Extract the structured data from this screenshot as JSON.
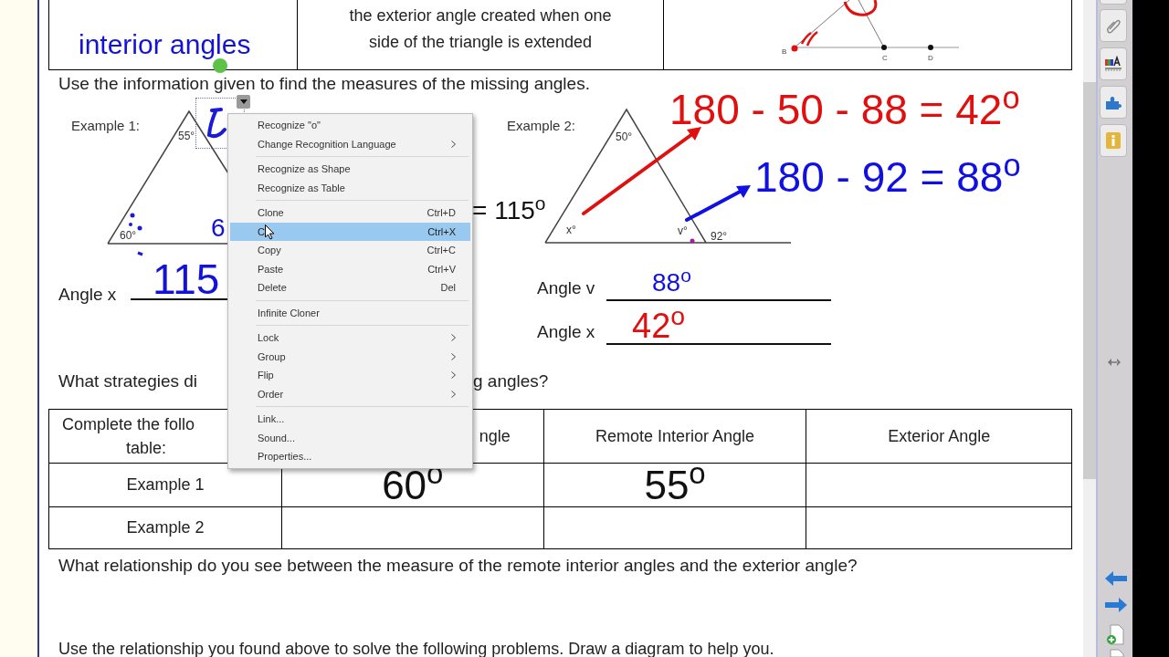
{
  "top_table": {
    "cell_1": "interior angles",
    "cell_2": [
      "the exterior angle created when one",
      "side of the triangle is extended"
    ],
    "drawing_labels": [
      "B",
      "C",
      "D"
    ]
  },
  "instructions": "Use the information given to find the measures of the missing angles.",
  "example_1": {
    "label": "Example 1:",
    "angle_labels": [
      "55°",
      "60°"
    ],
    "ink_digit": "6",
    "answer_label": "Angle x",
    "answer": "115",
    "equation": "= 115$^{o}$"
  },
  "example_2": {
    "label": "Example 2:",
    "angle_labels": [
      "50°",
      "x°",
      "v°",
      "92°"
    ],
    "equation_red": "180 - 50 - 88 = 42$^{o}$",
    "equation_blue": "180 - 92 = 88$^{o}$",
    "answers": [
      {
        "label": "Angle v",
        "value": "88$^{o}$",
        "color": "#1010e0"
      },
      {
        "label": "Angle x",
        "value": "42$^{o}$",
        "color": "#e01010"
      }
    ]
  },
  "question_parts": [
    "What strategies di",
    "g angles?"
  ],
  "table": {
    "header": [
      [
        "Complete the follo",
        "table:"
      ],
      "ngle",
      "Remote Interior Angle",
      "Exterior Angle"
    ],
    "rows": [
      {
        "label": "Example 1",
        "cells": [
          "60$^{o}$",
          "55$^{o}$"
        ]
      },
      {
        "label": "Example 2",
        "cells": []
      }
    ]
  },
  "relationship_question": "What relationship do you see between the measure of the remote interior angles and the exterior angle?",
  "use_relationship": "Use the relationship you found above to solve the following problems.  Draw a diagram to help you.",
  "context_menu": {
    "groups": [
      [
        {
          "label": "Recognize \"o\"",
          "submenu": false,
          "selected": false
        },
        {
          "label": "Change Recognition Language",
          "submenu": true,
          "selected": false
        }
      ],
      [
        {
          "label": "Recognize as Shape",
          "submenu": false,
          "selected": false
        },
        {
          "label": "Recognize as Table",
          "submenu": false,
          "selected": false
        }
      ],
      [
        {
          "label": "Clone",
          "shortcut": "Ctrl+D",
          "submenu": false,
          "selected": false
        },
        {
          "label": "C",
          "shortcut": "Ctrl+X",
          "submenu": false,
          "selected": true
        },
        {
          "label": "Copy",
          "shortcut": "Ctrl+C",
          "submenu": false,
          "selected": false
        },
        {
          "label": "Paste",
          "shortcut": "Ctrl+V",
          "submenu": false,
          "selected": false
        },
        {
          "label": "Delete",
          "shortcut": "Del",
          "submenu": false,
          "selected": false
        }
      ],
      [
        {
          "label": "Infinite Cloner",
          "submenu": false,
          "selected": false
        }
      ],
      [
        {
          "label": "Lock",
          "submenu": true,
          "selected": false
        },
        {
          "label": "Group",
          "submenu": true,
          "selected": false
        },
        {
          "label": "Flip",
          "submenu": true,
          "selected": false
        },
        {
          "label": "Order",
          "submenu": true,
          "selected": false
        }
      ],
      [
        {
          "label": "Link...",
          "submenu": false,
          "selected": false
        },
        {
          "label": "Sound...",
          "submenu": false,
          "selected": false
        },
        {
          "label": "Properties...",
          "submenu": false,
          "selected": false
        }
      ]
    ]
  }
}
